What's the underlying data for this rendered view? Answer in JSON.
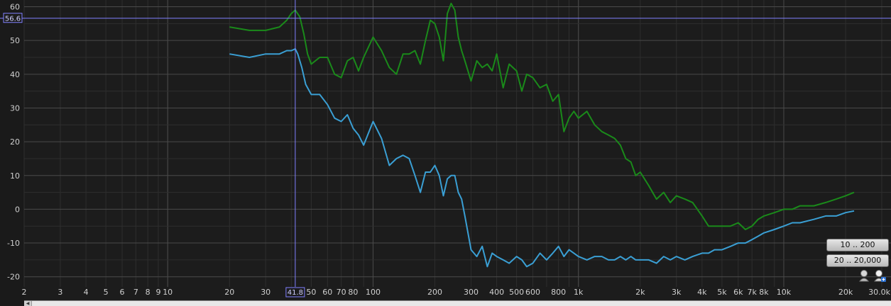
{
  "chart_data": {
    "type": "line",
    "x_scale": "log",
    "xlim": [
      2,
      30000
    ],
    "ylim": [
      -23,
      62
    ],
    "grid": true,
    "y_ticks": [
      "60",
      "50",
      "40",
      "30",
      "20",
      "10",
      "0",
      "-10",
      "-20"
    ],
    "x_ticks": [
      {
        "v": 2,
        "label": "2"
      },
      {
        "v": 3,
        "label": "3"
      },
      {
        "v": 4,
        "label": "4"
      },
      {
        "v": 5,
        "label": "5"
      },
      {
        "v": 6,
        "label": "6"
      },
      {
        "v": 7,
        "label": "7"
      },
      {
        "v": 8,
        "label": "8"
      },
      {
        "v": 9,
        "label": "9"
      },
      {
        "v": 10,
        "label": "10"
      },
      {
        "v": 20,
        "label": "20"
      },
      {
        "v": 30,
        "label": "30"
      },
      {
        "v": 50,
        "label": "50"
      },
      {
        "v": 60,
        "label": "60"
      },
      {
        "v": 70,
        "label": "70"
      },
      {
        "v": 80,
        "label": "80"
      },
      {
        "v": 100,
        "label": "100"
      },
      {
        "v": 200,
        "label": "200"
      },
      {
        "v": 300,
        "label": "300"
      },
      {
        "v": 400,
        "label": "400"
      },
      {
        "v": 500,
        "label": "500"
      },
      {
        "v": 600,
        "label": "600"
      },
      {
        "v": 800,
        "label": "800"
      },
      {
        "v": 1000,
        "label": "1k"
      },
      {
        "v": 2000,
        "label": "2k"
      },
      {
        "v": 3000,
        "label": "3k"
      },
      {
        "v": 4000,
        "label": "4k"
      },
      {
        "v": 5000,
        "label": "5k"
      },
      {
        "v": 6000,
        "label": "6k"
      },
      {
        "v": 7000,
        "label": "7k"
      },
      {
        "v": 8000,
        "label": "8k"
      },
      {
        "v": 10000,
        "label": "10k"
      },
      {
        "v": 20000,
        "label": "20k"
      },
      {
        "v": 30000,
        "label": "30.0k"
      }
    ],
    "cursor": {
      "x": 41.8,
      "x_label": "41.8",
      "y": 56.6,
      "y_label": "56.6"
    },
    "series": [
      {
        "color": "#1a8a1a",
        "x": [
          20,
          25,
          30,
          35,
          38,
          40,
          41.8,
          44,
          46,
          48,
          50,
          55,
          60,
          65,
          70,
          75,
          80,
          85,
          90,
          100,
          110,
          120,
          130,
          140,
          150,
          160,
          170,
          180,
          190,
          200,
          210,
          220,
          230,
          240,
          250,
          260,
          270,
          280,
          300,
          320,
          340,
          360,
          380,
          400,
          430,
          460,
          500,
          530,
          560,
          600,
          650,
          700,
          750,
          800,
          850,
          900,
          950,
          1000,
          1100,
          1200,
          1300,
          1400,
          1500,
          1600,
          1700,
          1800,
          1900,
          2000,
          2200,
          2400,
          2600,
          2800,
          3000,
          3300,
          3600,
          4000,
          4300,
          4600,
          5000,
          5500,
          6000,
          6500,
          7000,
          7500,
          8000,
          9000,
          10000,
          11000,
          12000,
          14000,
          16000,
          18000,
          20000,
          22000
        ],
        "y": [
          54,
          53,
          53,
          54,
          56,
          58,
          59,
          57,
          52,
          46,
          43,
          45,
          45,
          40,
          39,
          44,
          45,
          41,
          45,
          51,
          47,
          42,
          40,
          46,
          46,
          47,
          43,
          50,
          56,
          55,
          51,
          44,
          58,
          61,
          59,
          51,
          47,
          44,
          38,
          44,
          42,
          43,
          41,
          46,
          36,
          43,
          41,
          35,
          40,
          39,
          36,
          37,
          32,
          34,
          23,
          27,
          29,
          27,
          29,
          25,
          23,
          22,
          21,
          19,
          15,
          14,
          10,
          11,
          7,
          3,
          5,
          2,
          4,
          3,
          2,
          -2,
          -5,
          -5,
          -5,
          -5,
          -4,
          -6,
          -5,
          -3,
          -2,
          -1,
          0,
          0,
          1,
          1,
          2,
          3,
          4,
          5
        ]
      },
      {
        "color": "#3a9fd4",
        "x": [
          20,
          25,
          30,
          35,
          38,
          40,
          41.8,
          43,
          45,
          47,
          50,
          55,
          60,
          65,
          70,
          75,
          80,
          85,
          90,
          100,
          110,
          120,
          130,
          140,
          150,
          160,
          170,
          180,
          190,
          200,
          210,
          220,
          230,
          240,
          250,
          260,
          270,
          280,
          300,
          320,
          340,
          360,
          380,
          400,
          430,
          460,
          500,
          530,
          560,
          600,
          650,
          700,
          750,
          800,
          850,
          900,
          950,
          1000,
          1100,
          1200,
          1300,
          1400,
          1500,
          1600,
          1700,
          1800,
          1900,
          2000,
          2200,
          2400,
          2600,
          2800,
          3000,
          3300,
          3600,
          4000,
          4300,
          4600,
          5000,
          5500,
          6000,
          6500,
          7000,
          7500,
          8000,
          9000,
          10000,
          11000,
          12000,
          14000,
          16000,
          18000,
          20000,
          22000
        ],
        "y": [
          46,
          45,
          46,
          46,
          47,
          47,
          47.5,
          46,
          42,
          37,
          34,
          34,
          31,
          27,
          26,
          28,
          24,
          22,
          19,
          26,
          21,
          13,
          15,
          16,
          15,
          10,
          5,
          11,
          11,
          13,
          10,
          4,
          9,
          10,
          10,
          5,
          3,
          -2,
          -12,
          -14,
          -11,
          -17,
          -13,
          -14,
          -15,
          -16,
          -14,
          -15,
          -17,
          -16,
          -13,
          -15,
          -13,
          -11,
          -14,
          -12,
          -13,
          -14,
          -15,
          -14,
          -14,
          -15,
          -15,
          -14,
          -15,
          -14,
          -15,
          -15,
          -15,
          -16,
          -14,
          -15,
          -14,
          -15,
          -14,
          -13,
          -13,
          -12,
          -12,
          -11,
          -10,
          -10,
          -9,
          -8,
          -7,
          -6,
          -5,
          -4,
          -4,
          -3,
          -2,
          -2,
          -1,
          -0.5
        ]
      }
    ]
  },
  "buttons": {
    "range_a": "10 .. 200",
    "range_b": "20 .. 20,000"
  },
  "icons": {
    "zoom_out": "zoom-out-icon",
    "zoom_in": "zoom-in-icon",
    "scroll_left": "scroll-left-arrow-icon"
  },
  "colors": {
    "background": "#1c1c1c",
    "grid_major": "#4a4a4a",
    "grid_minor": "#2e2e2e",
    "cursor": "#8080ff"
  }
}
